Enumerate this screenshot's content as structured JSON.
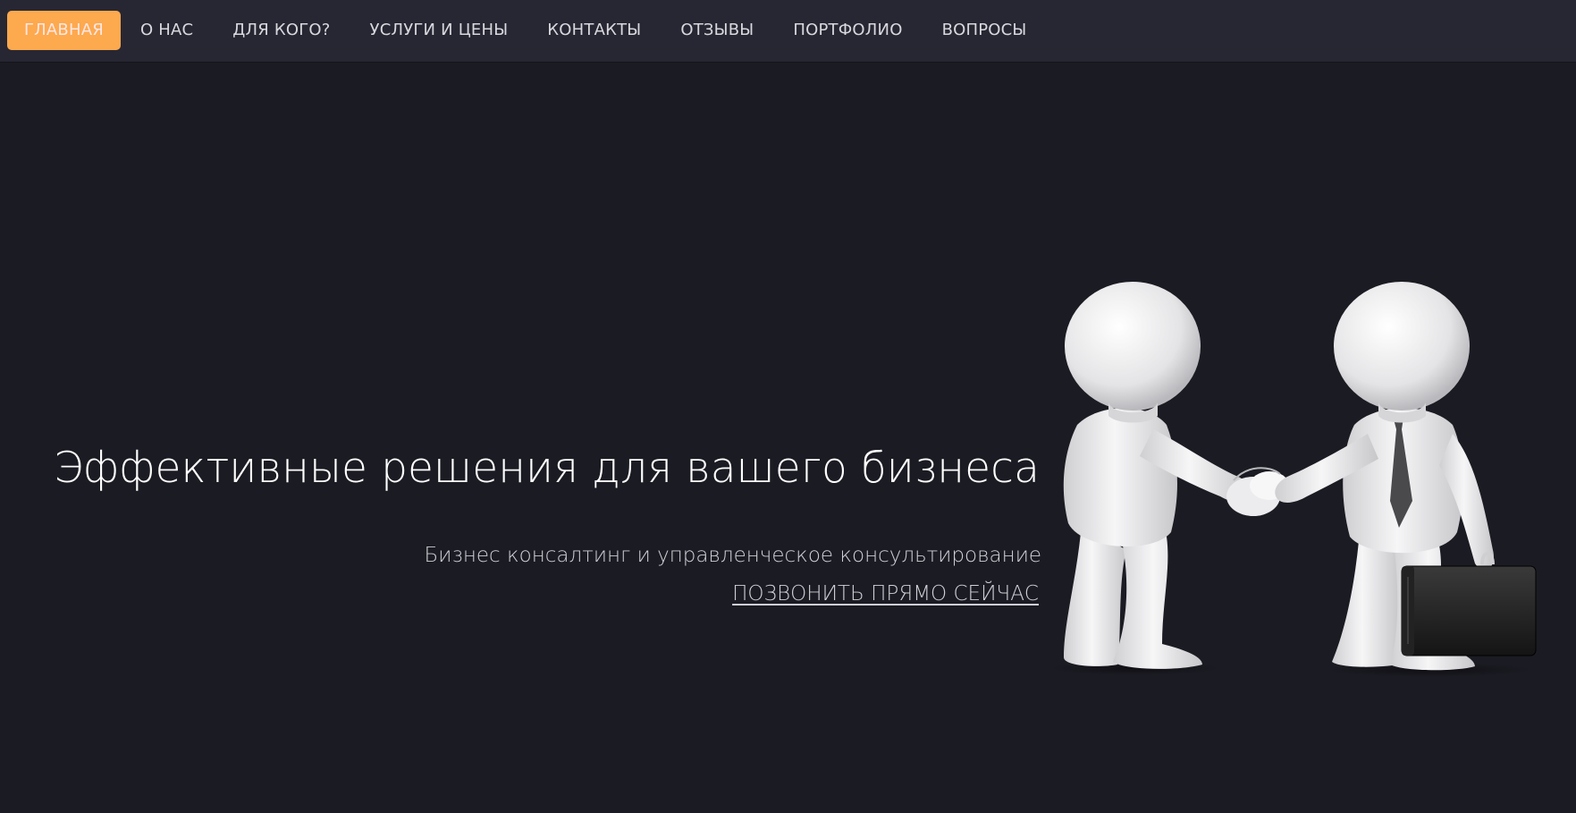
{
  "nav": {
    "items": [
      {
        "label": "ГЛАВНАЯ",
        "active": true
      },
      {
        "label": "О НАС",
        "active": false
      },
      {
        "label": "ДЛЯ КОГО?",
        "active": false
      },
      {
        "label": "УСЛУГИ И ЦЕНЫ",
        "active": false
      },
      {
        "label": "КОНТАКТЫ",
        "active": false
      },
      {
        "label": "ОТЗЫВЫ",
        "active": false
      },
      {
        "label": "ПОРТФОЛИО",
        "active": false
      },
      {
        "label": "ВОПРОСЫ",
        "active": false
      }
    ]
  },
  "hero": {
    "title": "Эффективные решения для вашего бизнеса",
    "subtitle": "Бизнес консалтинг и управленческое консультирование",
    "cta_label": "ПОЗВОНИТЬ ПРЯМО СЕЙЧАС",
    "illustration_name": "handshake-figures-illustration"
  },
  "colors": {
    "background": "#1b1b23",
    "navbar": "#272733",
    "accent": "#fda94e",
    "text": "#ffffff",
    "muted_text": "#cfcfd6"
  }
}
